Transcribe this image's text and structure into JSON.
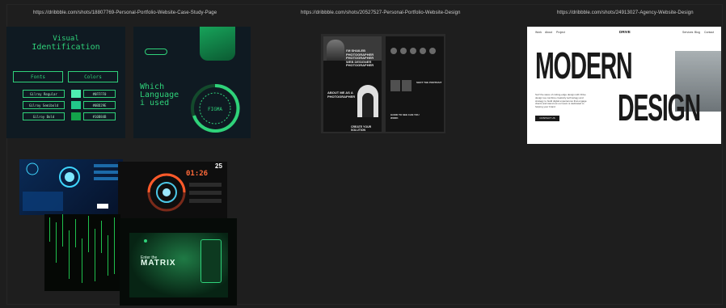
{
  "canvas": {
    "background": "#1e1e1e"
  },
  "urls": {
    "one": "https://dribbble.com/shots/18807769-Personal-Portfolio-Website-Case-Study-Page",
    "two": "https://dribbble.com/shots/20527527-Personal-Portfolio-Website-Design",
    "three": "https://dribbble.com/shots/24913027-Agency-Website-Design"
  },
  "board_portfolio_case": {
    "visual": "Visual",
    "identification": "Identification",
    "fonts_tab": "Fonts",
    "colors_tab": "Colors",
    "font_rows": [
      "Gilroy Regular",
      "Gilroy Semibold",
      "Gilroy Bold"
    ],
    "color_hexes": [
      "#0FFFF0",
      "#0BD29E",
      "#10B84B"
    ],
    "accent": "#2fd27a",
    "which": "Which",
    "language": "Language",
    "i_used": "i used",
    "dial_label": "FIGMA"
  },
  "board_personal_portfolio": {
    "hero_text": "I'M SHAILEB PHOTOGRAPHER PHOTOGRAPHER WEB DESIGNER PHOTOGRAPHER",
    "about_text": "ABOUT ME AS A PHOTOGRAPHER",
    "cta_text": "CREATE YOUR SOLUTION",
    "section_text": "SHOT THE PORTRAIT",
    "contact_text": "GOOD TO SEE CAN YOU WORK"
  },
  "board_agency": {
    "nav_left": [
      "Work",
      "About",
      "Project"
    ],
    "logo": "DRIVE",
    "nav_right": [
      "Services",
      "Blog",
      "Contact"
    ],
    "headline_1": "MODERN",
    "headline_2": "DESIGN",
    "description": "Surf the wave of cutting-edge design with Drive design we combine creativity technology and strategy to build digital experiences that engage clients and stand out our team is dedicated to helping your brand",
    "button": "CONTACT US"
  },
  "board_matrix": {
    "clock": "01:26",
    "counter": "25",
    "enter_the": "Enter the",
    "matrix": "MATRIX"
  }
}
